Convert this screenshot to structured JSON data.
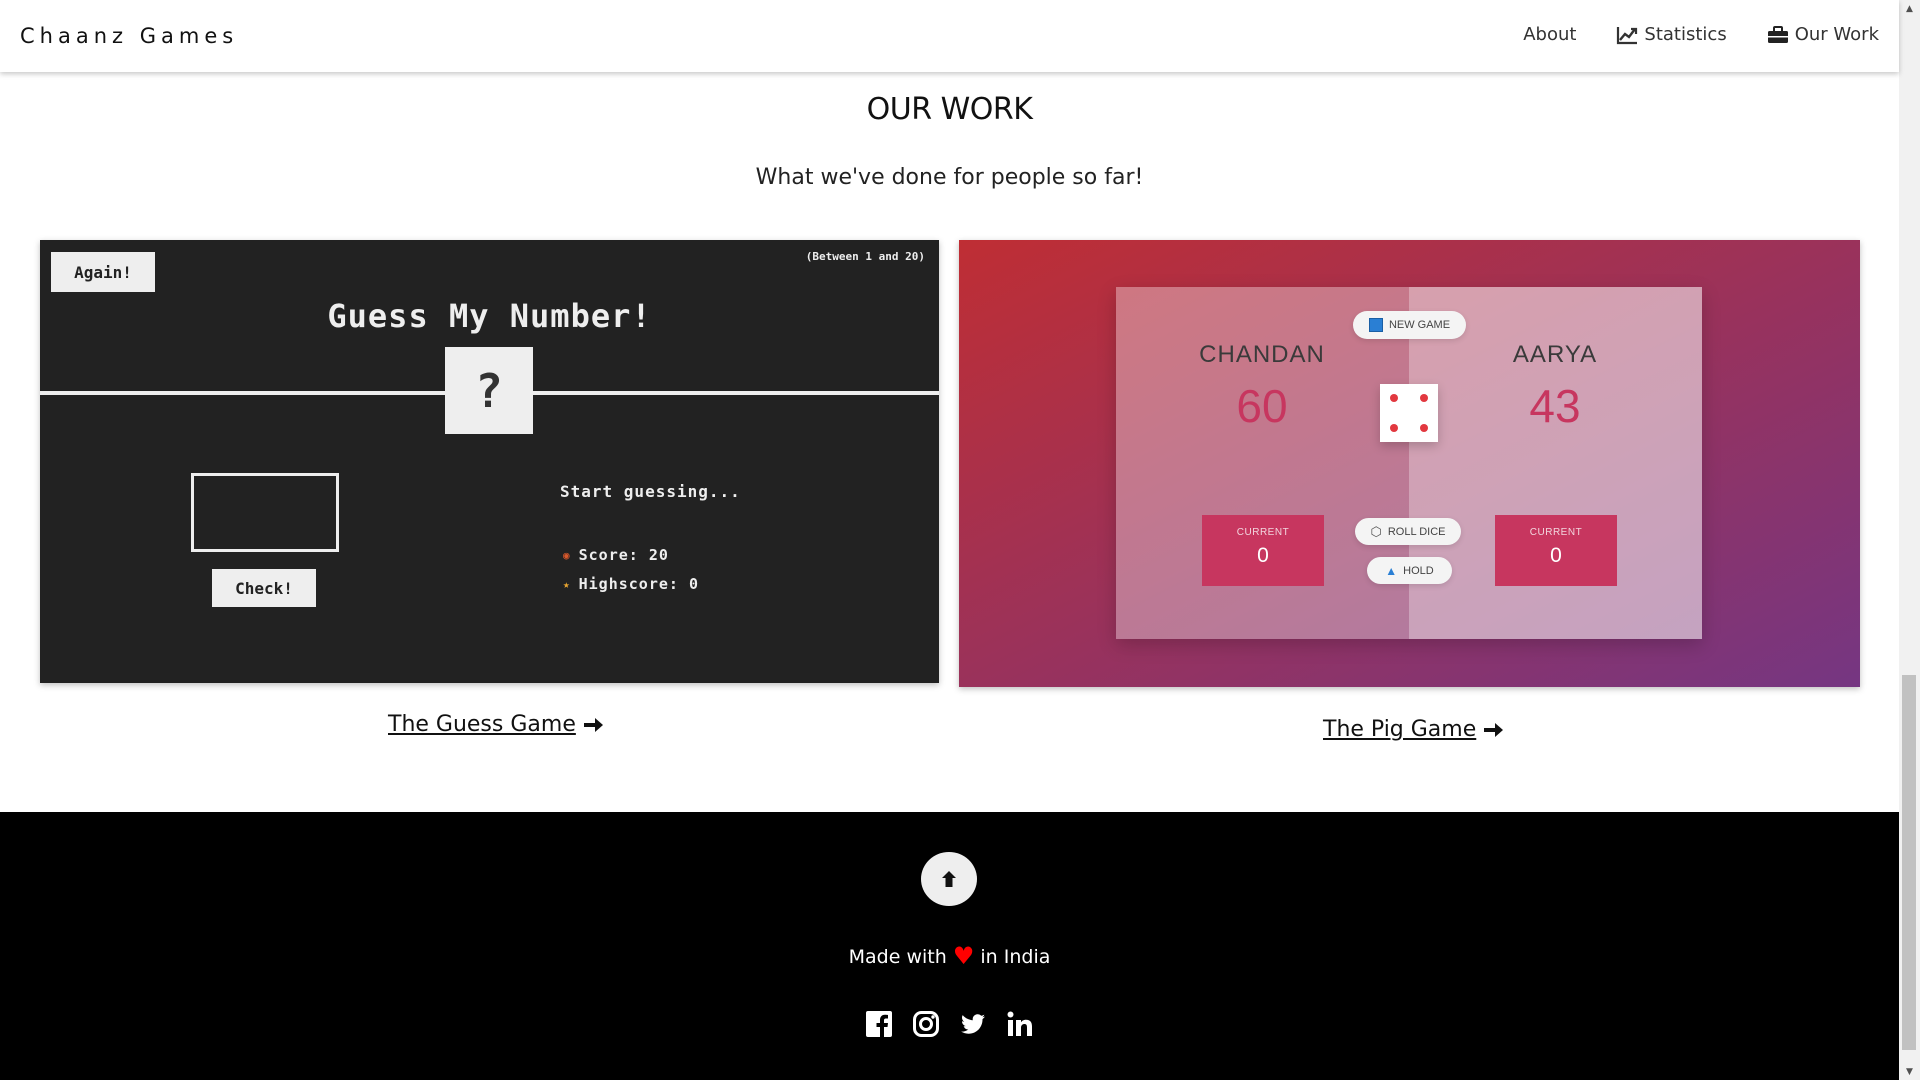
{
  "nav": {
    "brand": "Chaanz Games",
    "links": [
      {
        "label": "About",
        "icon": ""
      },
      {
        "label": "Statistics",
        "icon": "line-chart-icon"
      },
      {
        "label": "Our Work",
        "icon": "briefcase-icon"
      }
    ]
  },
  "section": {
    "title": "OUR WORK",
    "subtitle": "What we've done for people so far!"
  },
  "cards": [
    {
      "link_label": "The Guess Game",
      "preview": {
        "again_label": "Again!",
        "range_label": "(Between 1 and 20)",
        "title": "Guess My Number!",
        "secret": "?",
        "check_label": "Check!",
        "message": "Start guessing...",
        "score_label": "Score: 20",
        "highscore_label": "Highscore: 0"
      }
    },
    {
      "link_label": "The Pig Game",
      "preview": {
        "new_game_label": "NEW GAME",
        "player1_name": "CHANDAN",
        "player1_score": "60",
        "player1_current_label": "CURRENT",
        "player1_current_value": "0",
        "player2_name": "AARYA",
        "player2_score": "43",
        "player2_current_label": "CURRENT",
        "player2_current_value": "0",
        "roll_label": "ROLL DICE",
        "hold_label": "HOLD",
        "dice_value": 4
      }
    }
  ],
  "footer": {
    "made_prefix": "Made with",
    "made_suffix": "in India",
    "heart_color": "#ff0000",
    "socials": [
      "facebook-icon",
      "instagram-icon",
      "twitter-icon",
      "linkedin-icon"
    ]
  }
}
